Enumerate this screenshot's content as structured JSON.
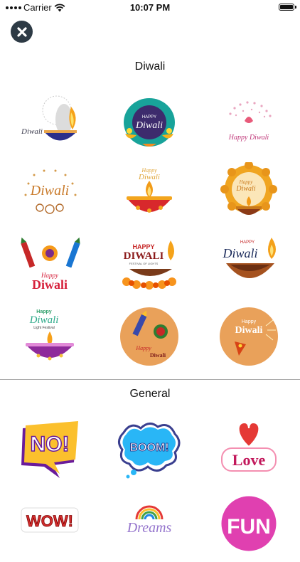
{
  "status_bar": {
    "carrier": "Carrier",
    "time": "10:07 PM"
  },
  "sections": [
    {
      "title": "Diwali",
      "stickers": [
        {
          "name": "diya-feather-sticker",
          "texts": [
            "Diwali"
          ]
        },
        {
          "name": "happy-diwali-green-badge-sticker",
          "texts": [
            "HAPPY",
            "Diwali"
          ]
        },
        {
          "name": "happy-diwali-pink-dots-sticker",
          "texts": [
            "Happy Diwali"
          ]
        },
        {
          "name": "diwali-swirl-lettering-sticker",
          "texts": [
            "Diwali"
          ]
        },
        {
          "name": "happy-diwali-red-diya-sticker",
          "texts": [
            "Happy",
            "Diwali"
          ]
        },
        {
          "name": "happy-diwali-flower-diya-sticker",
          "texts": [
            "Happy",
            "Diwali"
          ]
        },
        {
          "name": "happy-diwali-firecrackers-sticker",
          "texts": [
            "Happy",
            "Diwali"
          ]
        },
        {
          "name": "happy-diwali-festival-of-lights-sticker",
          "texts": [
            "HAPPY",
            "DIWALI",
            "FESTIVAL OF LIGHTS"
          ]
        },
        {
          "name": "happy-diwali-oil-lamp-sticker",
          "texts": [
            "HAPPY",
            "Diwali"
          ]
        },
        {
          "name": "happy-diwali-light-festival-sticker",
          "texts": [
            "Happy",
            "Diwali",
            "Light Festival"
          ]
        },
        {
          "name": "happy-diwali-orange-circle-rocket-sticker",
          "texts": [
            "Happy",
            "Diwali"
          ]
        },
        {
          "name": "happy-diwali-orange-circle-sparkler-sticker",
          "texts": [
            "Happy",
            "Diwali"
          ]
        }
      ]
    },
    {
      "title": "General",
      "stickers": [
        {
          "name": "no-speech-bubble-sticker",
          "texts": [
            "NO!"
          ]
        },
        {
          "name": "boom-comic-sticker",
          "texts": [
            "BOOM!"
          ]
        },
        {
          "name": "love-heart-sticker",
          "texts": [
            "Love"
          ]
        },
        {
          "name": "wow-sticker",
          "texts": [
            "WOW!"
          ]
        },
        {
          "name": "dreams-rainbow-sticker",
          "texts": [
            "Dreams"
          ]
        },
        {
          "name": "fun-badge-sticker",
          "texts": [
            "FUN"
          ]
        }
      ]
    }
  ],
  "colors": {
    "close_button": "#2d3a45",
    "divider": "#aaaaaa"
  }
}
